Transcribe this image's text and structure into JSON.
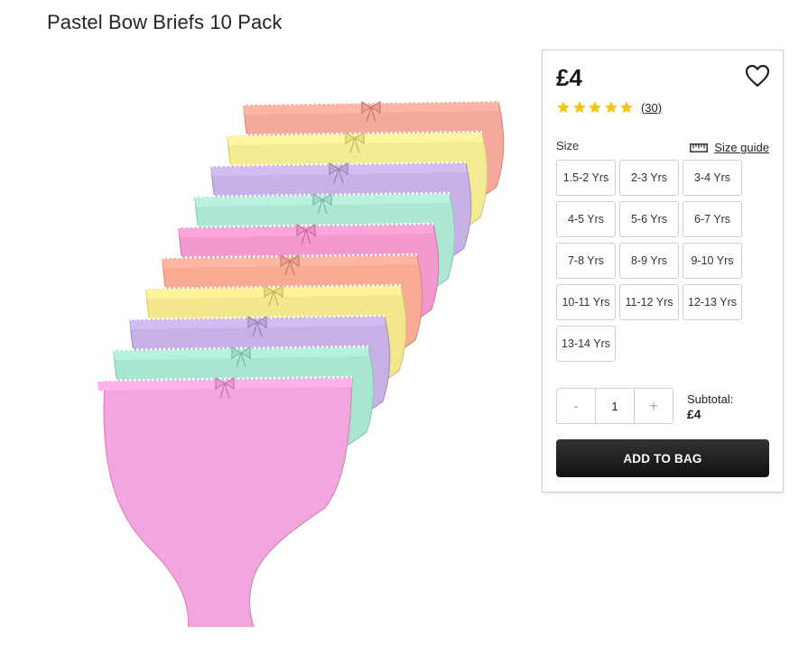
{
  "product": {
    "title": "Pastel Bow Briefs 10 Pack",
    "image_icon": "product-photo"
  },
  "buy_box": {
    "price": "£4",
    "rating": {
      "stars": 5,
      "max": 5,
      "review_count": "(30)"
    },
    "size_label": "Size",
    "size_guide_label": "Size guide",
    "sizes": [
      "1.5-2 Yrs",
      "2-3 Yrs",
      "3-4 Yrs",
      "4-5 Yrs",
      "5-6 Yrs",
      "6-7 Yrs",
      "7-8 Yrs",
      "8-9 Yrs",
      "9-10 Yrs",
      "10-11 Yrs",
      "11-12 Yrs",
      "12-13 Yrs",
      "13-14 Yrs"
    ],
    "quantity": {
      "minus": "-",
      "value": "1",
      "plus": "+"
    },
    "subtotal_label": "Subtotal:",
    "subtotal_value": "£4",
    "add_to_bag_label": "ADD TO BAG"
  },
  "colors": {
    "star": "#f5c518",
    "button_dark": "#1a1a1a",
    "border": "#cfcfcf",
    "brief_colors": [
      "#f5a99a",
      "#f3ea93",
      "#c7b1e6",
      "#aee6d4",
      "#f29ad0",
      "#f7ab95",
      "#f2e78d",
      "#c6b0e6",
      "#a9e6d1",
      "#f3a5dd"
    ]
  }
}
